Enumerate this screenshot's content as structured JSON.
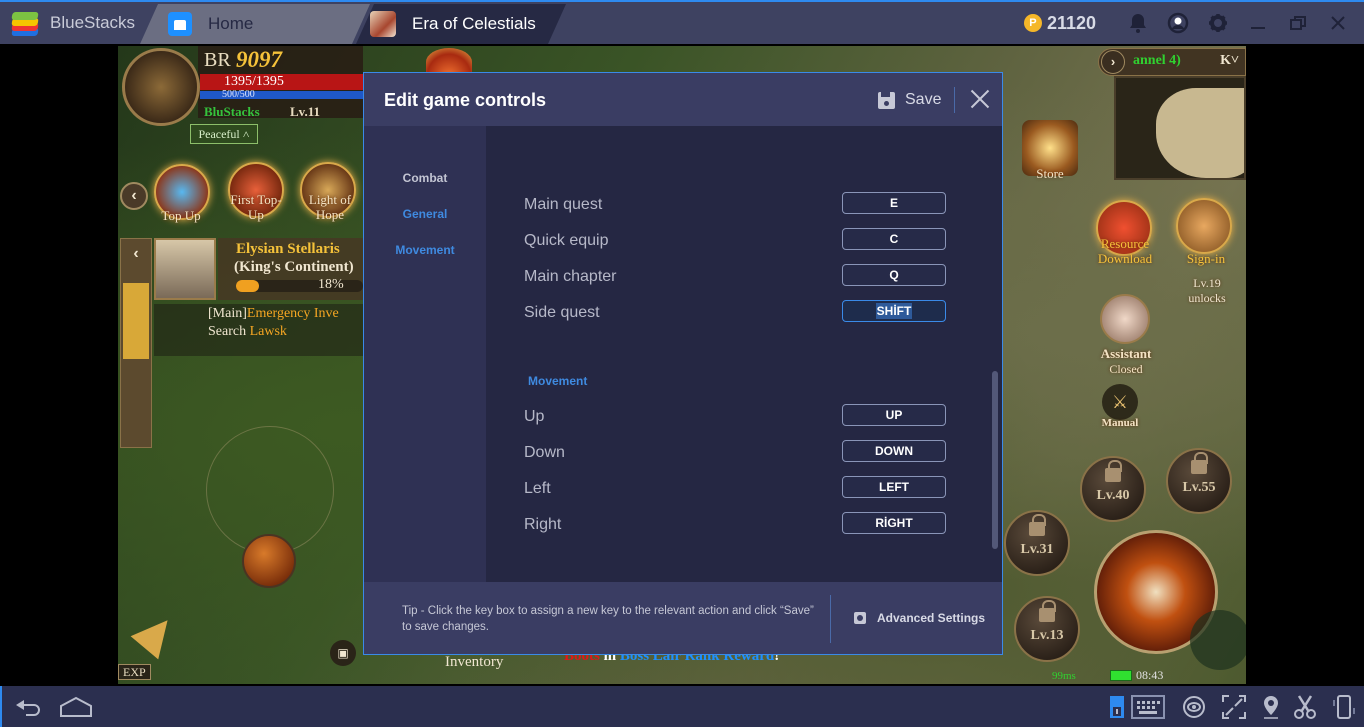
{
  "titlebar": {
    "app_name": "BlueStacks",
    "tabs": [
      {
        "label": "Home",
        "icon": "home-icon"
      },
      {
        "label": "Era of Celestials",
        "icon": "game-icon"
      }
    ],
    "coins": "21120",
    "coin_symbol": "P",
    "icons": [
      "bell-icon",
      "account-icon",
      "gear-icon",
      "minimize-icon",
      "restore-icon",
      "close-icon"
    ]
  },
  "game": {
    "br_label": "BR",
    "br_value": "9097",
    "hp": "1395/1395",
    "mp": "500/500",
    "player_name": "BluStacks",
    "player_level": "Lv.11",
    "mode": "Peaceful",
    "events": [
      {
        "label": "Top Up"
      },
      {
        "label": "First Top-Up"
      },
      {
        "label": "Light of Hope"
      }
    ],
    "quest": {
      "title": "Elysian Stellaris",
      "subtitle": "(King's Continent)",
      "progress_percent": 18,
      "progress_label": "18%",
      "task_prefix": "[Main]",
      "task_name": "Emergency Inve",
      "task_line2_prefix": "Search",
      "task_line2_target": "Lawsk"
    },
    "channel": "annel 4)",
    "map_key": "K",
    "store": "Store",
    "resource_download": "Resource Download",
    "sign_in": "Sign-in",
    "sign_in_sub": "Lv.19 unlocks",
    "assistant": "Assistant",
    "assistant_status": "Closed",
    "manual": "Manual",
    "skills": [
      "Lv.40",
      "Lv.55",
      "Lv.31",
      "Lv.13"
    ],
    "exp_label": "EXP",
    "inventory": "Inventory",
    "broadcast": {
      "red": "Boots",
      "white": " in ",
      "blue": "Boss Lair Rank Reward",
      "end": "!"
    },
    "ping": "99ms",
    "time": "08:43"
  },
  "dialog": {
    "title": "Edit game controls",
    "save_label": "Save",
    "sidebar": [
      {
        "label": "Combat",
        "active": false
      },
      {
        "label": "General",
        "active": true
      },
      {
        "label": "Movement",
        "active": true
      }
    ],
    "general_rows": [
      {
        "label": "Main quest",
        "key": "E"
      },
      {
        "label": "Quick equip",
        "key": "C"
      },
      {
        "label": "Main chapter",
        "key": "Q"
      },
      {
        "label": "Side quest",
        "key": "SHİFT",
        "selected": true
      }
    ],
    "movement_title": "Movement",
    "movement_rows": [
      {
        "label": "Up",
        "key": "UP"
      },
      {
        "label": "Down",
        "key": "DOWN"
      },
      {
        "label": "Left",
        "key": "LEFT"
      },
      {
        "label": "Right",
        "key": "RİGHT"
      }
    ],
    "tip": "Tip - Click the key box to assign a new key to the relevant action and click “Save” to save changes.",
    "advanced_label": "Advanced Settings"
  },
  "bottombar": {
    "left_icons": [
      "back-icon",
      "home-icon"
    ],
    "right_icons": [
      "keymapping-toggle-icon",
      "keyboard-icon",
      "eye-icon",
      "fullscreen-icon",
      "location-icon",
      "scissors-icon",
      "shake-icon"
    ]
  }
}
